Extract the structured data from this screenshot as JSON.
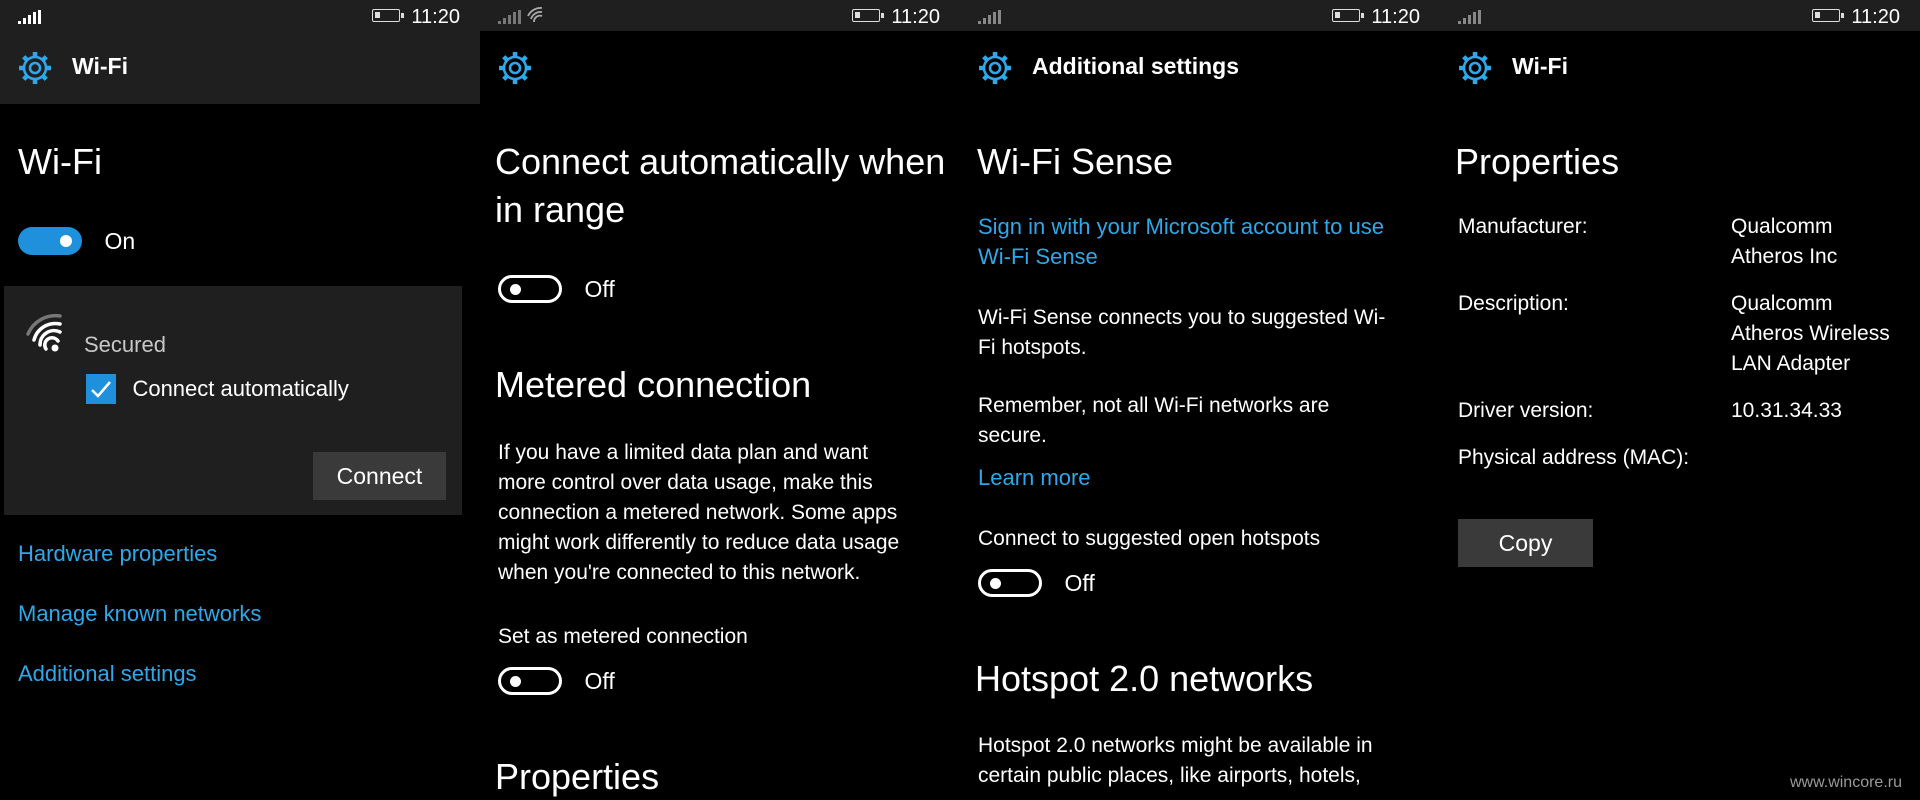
{
  "status": {
    "time": "11:20"
  },
  "colors": {
    "accent": "#1e90dc",
    "link": "#2ea8ea",
    "background": "#000000",
    "header": "#1f1f1f"
  },
  "panel1": {
    "header_title": "Wi-Fi",
    "title": "Wi-Fi",
    "toggle_label": "On",
    "network": {
      "security": "Secured",
      "checkbox_label": "Connect automatically",
      "checked": true,
      "connect_button": "Connect"
    },
    "links": [
      "Hardware properties",
      "Manage known networks",
      "Additional settings"
    ]
  },
  "panel2": {
    "title_line1": "Connect automatically when",
    "title_line2": "in range",
    "auto_toggle": "Off",
    "metered_heading": "Metered connection",
    "metered_description": [
      "If you have a limited data plan and want",
      "more control over data usage, make this",
      "connection a metered network. Some apps",
      "might work differently to reduce data usage",
      "when you're connected to this network."
    ],
    "set_metered_label": "Set as metered connection",
    "metered_toggle": "Off",
    "properties_heading": "Properties"
  },
  "panel3": {
    "header_title": "Additional settings",
    "title": "Wi-Fi Sense",
    "signin_link_line1": "Sign in with your Microsoft account to use",
    "signin_link_line2": "Wi-Fi Sense",
    "desc1_line1": "Wi-Fi Sense connects you to suggested Wi-",
    "desc1_line2": "Fi hotspots.",
    "desc2_line1": "Remember, not all Wi-Fi networks are",
    "desc2_line2": "secure.",
    "learn_more": "Learn more",
    "suggested_label": "Connect to suggested open hotspots",
    "suggested_toggle": "Off",
    "hotspot_heading": "Hotspot 2.0 networks",
    "hotspot_line1": "Hotspot 2.0 networks might be available in",
    "hotspot_line2": "certain public places, like airports, hotels,"
  },
  "panel4": {
    "header_title": "Wi-Fi",
    "title": "Properties",
    "props": [
      {
        "label": "Manufacturer:",
        "value": [
          "Qualcomm",
          "Atheros Inc"
        ]
      },
      {
        "label": "Description:",
        "value": [
          "Qualcomm",
          "Atheros Wireless",
          "LAN Adapter"
        ]
      },
      {
        "label": "Driver version:",
        "value": [
          "10.31.34.33"
        ]
      },
      {
        "label": "Physical address (MAC):",
        "value": []
      }
    ],
    "copy_button": "Copy"
  },
  "watermark": "www.wincore.ru"
}
